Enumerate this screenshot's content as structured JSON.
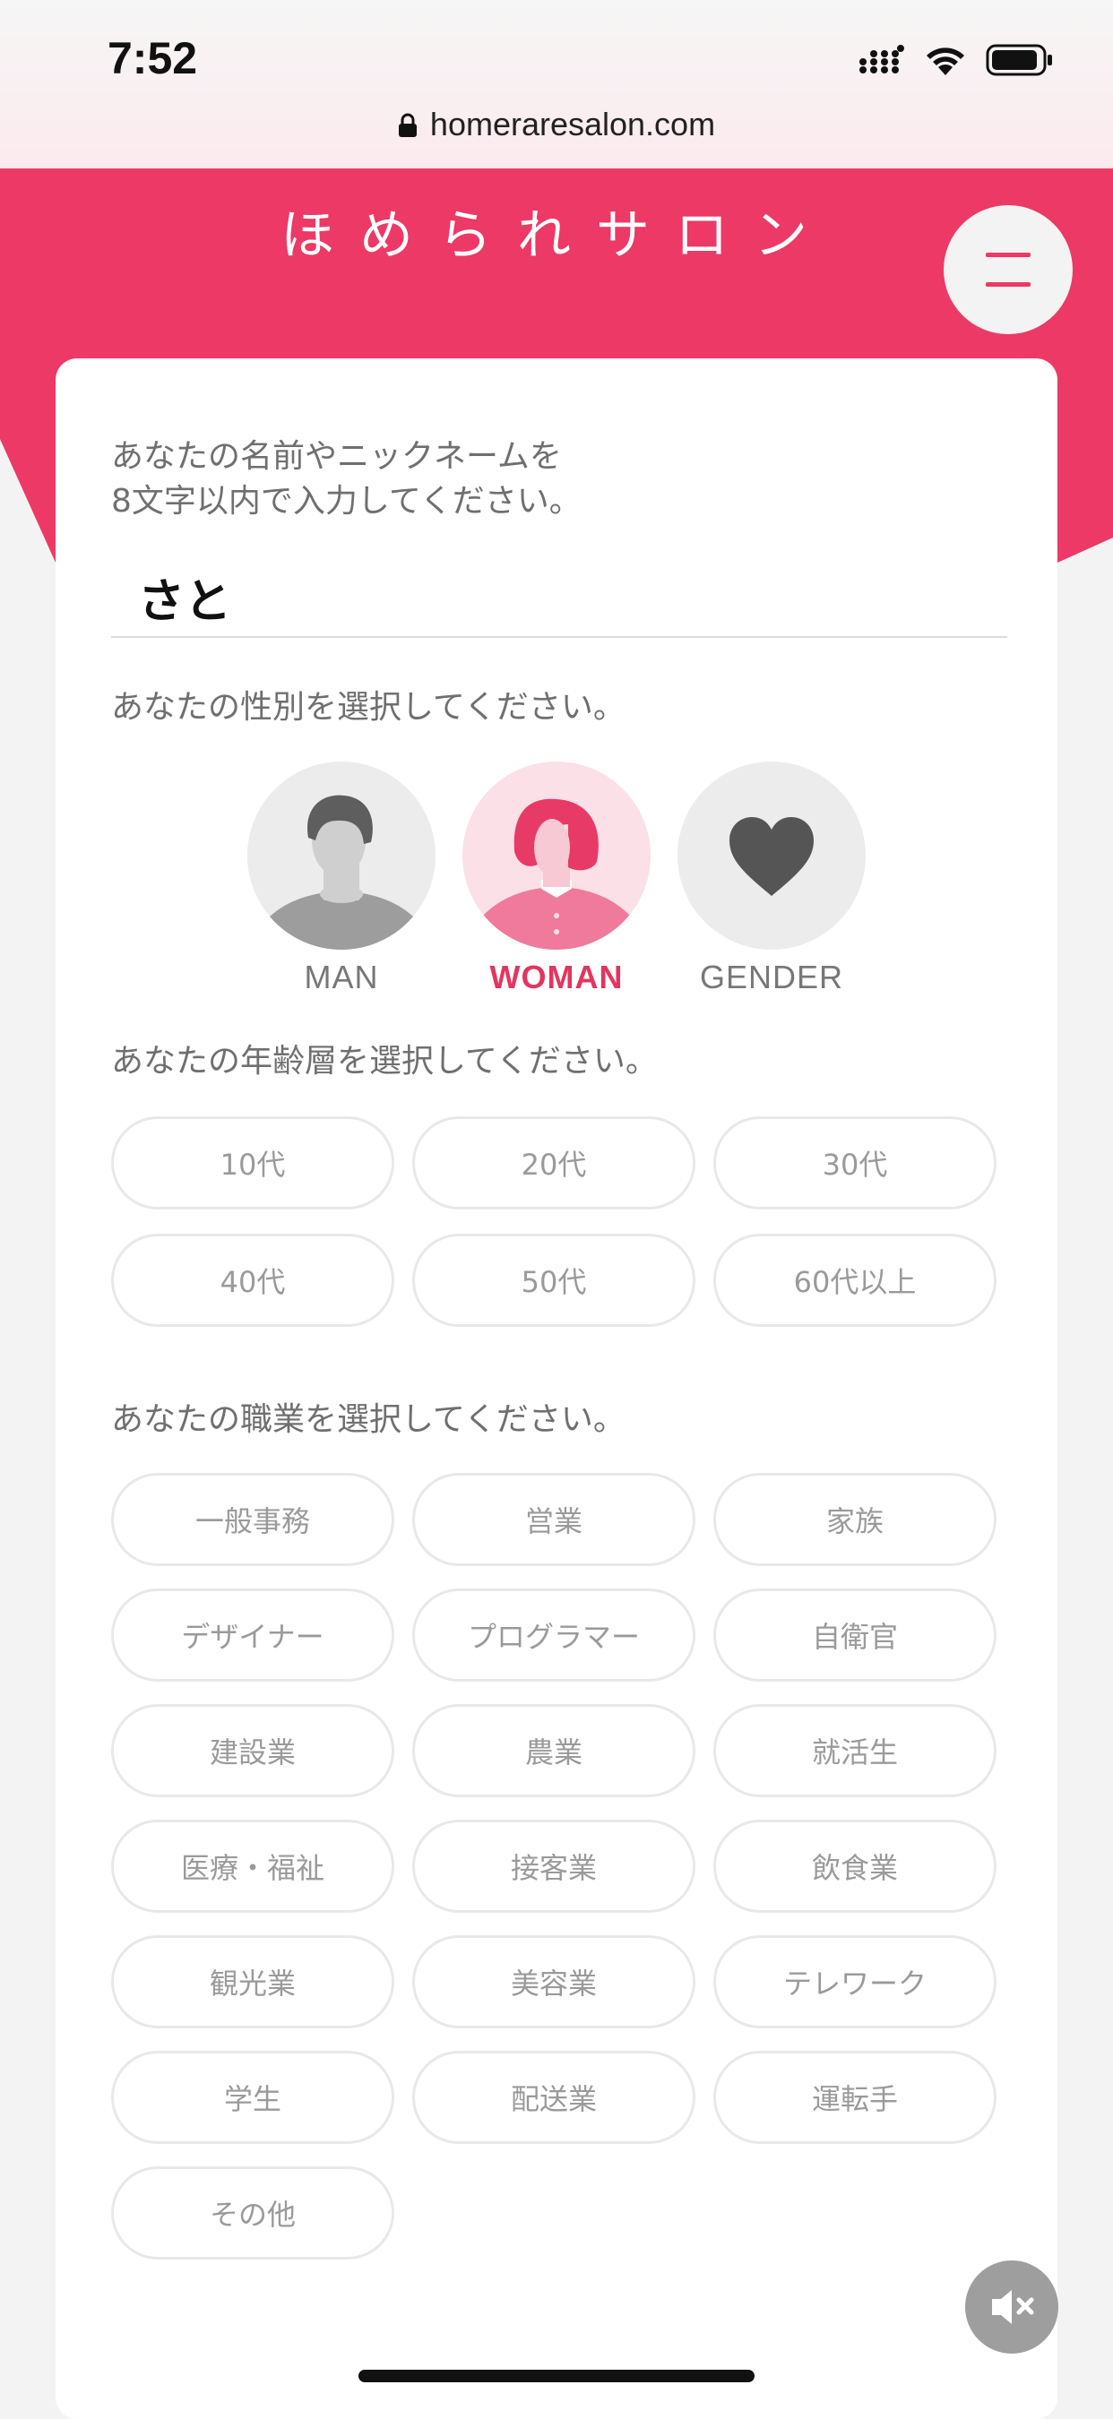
{
  "status_bar": {
    "time": "7:52",
    "url": "homeraresalon.com"
  },
  "header": {
    "site_title": "ほめられサロン",
    "menu_icon": "hamburger-menu-icon"
  },
  "name_section": {
    "prompt_line1": "あなたの名前やニックネームを",
    "prompt_line2": "8文字以内で入力してください。",
    "value": "さと"
  },
  "gender_section": {
    "prompt": "あなたの性別を選択してください。",
    "options": [
      {
        "label": "MAN",
        "icon": "man-avatar-icon",
        "selected": false
      },
      {
        "label": "WOMAN",
        "icon": "woman-avatar-icon",
        "selected": true
      },
      {
        "label": "GENDER",
        "icon": "heart-icon",
        "selected": false
      }
    ]
  },
  "age_section": {
    "prompt": "あなたの年齢層を選択してください。",
    "options": [
      "10代",
      "20代",
      "30代",
      "40代",
      "50代",
      "60代以上"
    ]
  },
  "job_section": {
    "prompt": "あなたの職業を選択してください。",
    "options": [
      "一般事務",
      "営業",
      "家族",
      "デザイナー",
      "プログラマー",
      "自衛官",
      "建設業",
      "農業",
      "就活生",
      "医療・福祉",
      "接客業",
      "飲食業",
      "観光業",
      "美容業",
      "テレワーク",
      "学生",
      "配送業",
      "運転手",
      "その他"
    ]
  },
  "colors": {
    "brand": "#ec3966",
    "selected_label": "#e2365f",
    "pill_border": "#e8e8e8",
    "pill_text": "#9a9a9a"
  },
  "floating": {
    "mute_icon": "speaker-muted-icon"
  }
}
